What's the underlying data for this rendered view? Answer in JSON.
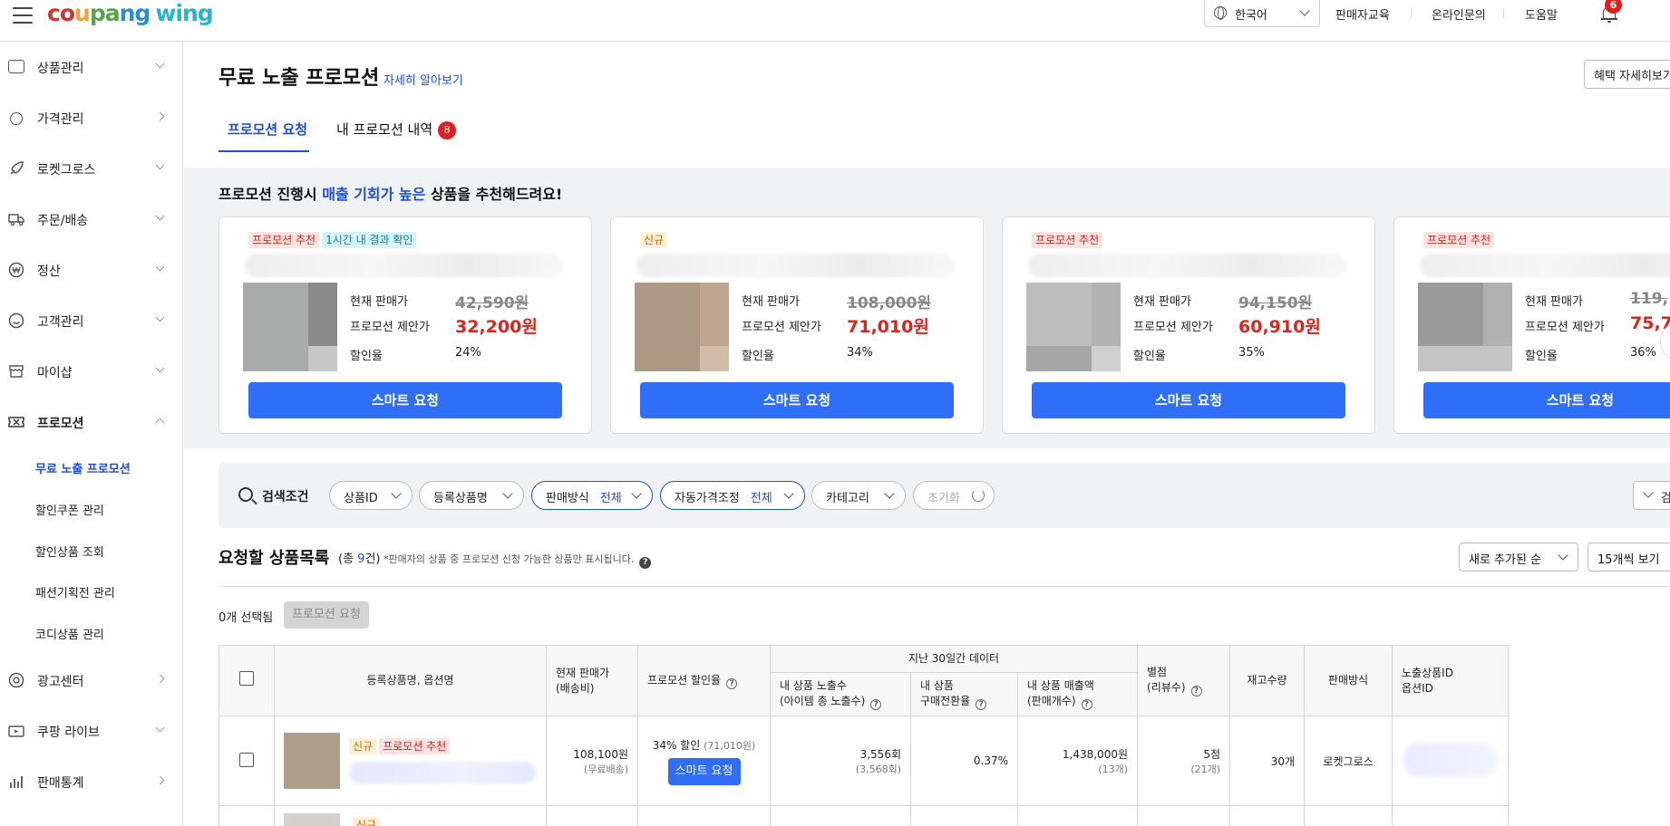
{
  "header": {
    "logo": {
      "coupang": [
        "c",
        "o",
        "u",
        "p",
        "a",
        "n",
        "g"
      ],
      "wing": "wing"
    },
    "language": "한국어",
    "links": [
      "판매자교육",
      "온라인문의",
      "도움말"
    ],
    "notification_count": "6"
  },
  "sidebar": {
    "items": [
      {
        "label": "상품관리",
        "icon": "box-icon"
      },
      {
        "label": "가격관리",
        "icon": "price-tag-icon"
      },
      {
        "label": "로켓그로스",
        "icon": "rocket-icon"
      },
      {
        "label": "주문/배송",
        "icon": "truck-icon"
      },
      {
        "label": "정산",
        "icon": "won-coin-icon"
      },
      {
        "label": "고객관리",
        "icon": "smile-icon"
      },
      {
        "label": "마이샵",
        "icon": "shop-icon"
      },
      {
        "label": "프로모션",
        "icon": "ticket-icon"
      },
      {
        "label": "광고센터",
        "icon": "target-icon"
      },
      {
        "label": "쿠팡 라이브",
        "icon": "live-tv-icon"
      },
      {
        "label": "판매통계",
        "icon": "bar-chart-icon"
      }
    ],
    "promotion_sub": [
      "무료 노출 프로모션",
      "할인쿠폰 관리",
      "할인상품 조회",
      "패션기획전 관리",
      "코디상품 관리"
    ]
  },
  "page": {
    "title": "무료 노출 프로모션",
    "learn_more": "자세히 알아보기",
    "benefit_button": "혜택 자세히보기",
    "tabs": [
      {
        "label": "프로모션 요청"
      },
      {
        "label": "내 프로모션 내역",
        "count": "8"
      }
    ]
  },
  "recommend": {
    "title_prefix": "프로모션 진행시 ",
    "title_highlight": "매출 기회가 높은",
    "title_suffix": " 상품을 추천해드려요!",
    "labels": {
      "current": "현재 판매가",
      "proposed": "프로모션 제안가",
      "rate": "할인율"
    },
    "button": "스마트 요청",
    "cards": [
      {
        "tags": [
          {
            "text": "프로모션 추천",
            "style": "red"
          },
          {
            "text": "1시간 내 결과 확인",
            "style": "cyan"
          }
        ],
        "current": "42,590원",
        "proposed": "32,200원",
        "rate": "24%"
      },
      {
        "tags": [
          {
            "text": "신규",
            "style": "orange"
          }
        ],
        "current": "108,000원",
        "proposed": "71,010원",
        "rate": "34%"
      },
      {
        "tags": [
          {
            "text": "프로모션 추천",
            "style": "red"
          }
        ],
        "current": "94,150원",
        "proposed": "60,910원",
        "rate": "35%"
      },
      {
        "tags": [
          {
            "text": "프로모션 추천",
            "style": "red"
          }
        ],
        "current": "119,",
        "proposed": "75,7",
        "rate": "36%"
      }
    ]
  },
  "search": {
    "label": "검색조건",
    "filters": [
      {
        "label": "상품ID",
        "value": ""
      },
      {
        "label": "등록상품명",
        "value": ""
      },
      {
        "label": "판매방식",
        "value": "전체"
      },
      {
        "label": "자동가격조정",
        "value": "전체"
      },
      {
        "label": "카테고리",
        "value": ""
      }
    ],
    "reset": "초기화",
    "open": "검색 열기"
  },
  "list": {
    "title": "요청할 상품목록",
    "count_prefix": "(총 ",
    "count": "9",
    "count_suffix": "건)",
    "note": "*판매자의 상품 중 프로모션 신청 가능한 상품만 표시됩니다.",
    "sort": "새로 추가된 순",
    "page_size": "15개씩 보기",
    "selected": "0개 선택됨",
    "request_button": "프로모션 요청"
  },
  "table": {
    "group_header": "지난 30일간 데이터",
    "headers": {
      "name": "등록상품명, 옵션명",
      "price": "현재 판매가",
      "price_sub": "(배송비)",
      "rate": "프로모션 할인율",
      "views": "내 상품 노출수",
      "views_sub": "(아이템 총 노출수)",
      "conv": "내 상품",
      "conv_sub": "구매전환율",
      "sales": "내 상품 매출액",
      "sales_sub": "(판매개수)",
      "rating": "별점",
      "rating_sub": "(리뷰수)",
      "stock": "재고수량",
      "method": "판매방식",
      "ids": "노출상품ID",
      "ids_sub": "옵션ID"
    },
    "rows": [
      {
        "tags": [
          "신규",
          "프로모션 추천"
        ],
        "price": "108,100원",
        "shipping": "(무료배송)",
        "discount": "34% 할인",
        "discount_price": "(71,010원)",
        "button": "스마트 요청",
        "views": "3,556회",
        "views_total": "(3,568회)",
        "conv": "0.37%",
        "sales": "1,438,000원",
        "sales_count": "(13개)",
        "rating": "5점",
        "reviews": "(21개)",
        "stock": "30개",
        "method": "로켓그로스"
      }
    ],
    "next_row_tag": "신규"
  }
}
